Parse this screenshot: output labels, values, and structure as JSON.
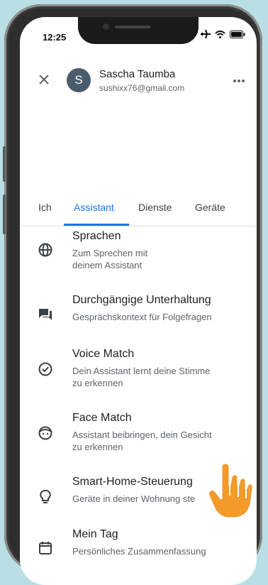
{
  "status": {
    "time": "12:25"
  },
  "user": {
    "initial": "S",
    "name": "Sascha Taumba",
    "email": "sushixx76@gmail.com"
  },
  "tabs": [
    {
      "label": "Ich",
      "active": false
    },
    {
      "label": "Assistant",
      "active": true
    },
    {
      "label": "Dienste",
      "active": false
    },
    {
      "label": "Geräte",
      "active": false
    }
  ],
  "settings": [
    {
      "title": "Sprachen",
      "subtitle_lines": [
        "Zum Sprechen mit",
        "deinem Assistant"
      ],
      "icon": "globe-icon"
    },
    {
      "title": "Durchgängige Unterhaltung",
      "subtitle_lines": [
        "Gesprächskontext für Folgefragen"
      ],
      "icon": "chat-icon"
    },
    {
      "title": "Voice Match",
      "subtitle_lines": [
        "Dein Assistant lernt deine Stimme",
        "zu erkennen"
      ],
      "icon": "voice-check-icon"
    },
    {
      "title": "Face Match",
      "subtitle_lines": [
        "Assistant beibringen, dein Gesicht",
        "zu erkennen"
      ],
      "icon": "face-icon"
    },
    {
      "title": "Smart-Home-Steuerung",
      "subtitle_lines": [
        "Geräte in deiner Wohnung ste"
      ],
      "icon": "lightbulb-icon"
    },
    {
      "title": "Mein Tag",
      "subtitle_lines": [
        "Persönliches Zusammenfassung"
      ],
      "icon": "calendar-icon"
    }
  ],
  "colors": {
    "accent": "#1a73e8",
    "background": "#b9dfe4",
    "hand": "#f39a2b"
  }
}
